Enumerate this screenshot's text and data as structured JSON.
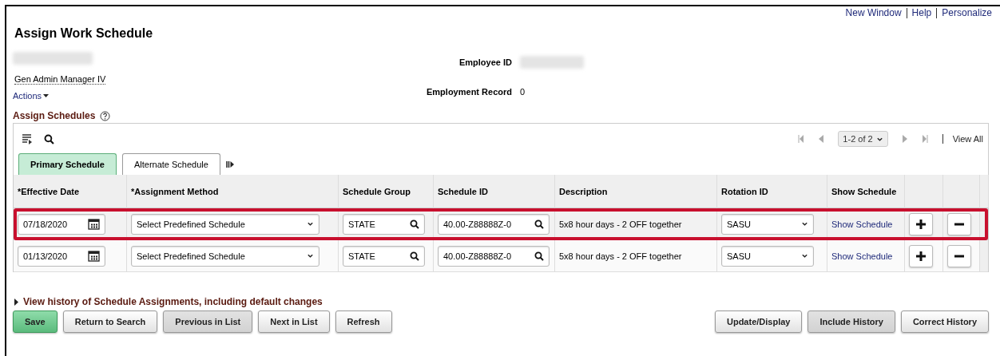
{
  "top_links": [
    "New Window",
    "Help",
    "Personalize"
  ],
  "page_title": "Assign Work Schedule",
  "header": {
    "name": {
      "kind": "redacted"
    },
    "job_title": "Gen Admin Manager IV",
    "actions": "Actions",
    "fields": [
      {
        "label": "Employee ID",
        "value": {
          "kind": "redacted"
        }
      },
      {
        "label": "Employment Record",
        "value": "0"
      }
    ]
  },
  "section_title": "Assign Schedules",
  "pager": {
    "range": "1-2 of 2",
    "view_all": "View All"
  },
  "tabs": [
    {
      "label": "Primary Schedule",
      "selected": true
    },
    {
      "label": "Alternate Schedule",
      "selected": false
    }
  ],
  "table": {
    "columns": [
      "*Effective Date",
      "*Assignment Method",
      "Schedule Group",
      "Schedule ID",
      "Description",
      "Rotation ID",
      "Show Schedule"
    ],
    "rows": [
      {
        "effective_date": "07/18/2020",
        "assignment_method": "Select Predefined Schedule",
        "schedule_group": "STATE",
        "schedule_id": "40.00-Z88888Z-0",
        "description": "5x8 hour days - 2 OFF together",
        "rotation_id": "SASU",
        "show_schedule": "Show Schedule",
        "highlighted": true
      },
      {
        "effective_date": "01/13/2020",
        "assignment_method": "Select Predefined Schedule",
        "schedule_group": "STATE",
        "schedule_id": "40.00-Z88888Z-0",
        "description": "5x8 hour days - 2 OFF together",
        "rotation_id": "SASU",
        "show_schedule": "Show Schedule",
        "highlighted": false
      }
    ]
  },
  "history_link": "View history of Schedule Assignments, including default changes",
  "buttons_left": [
    {
      "label": "Save",
      "kind": "primary",
      "disabled": false
    },
    {
      "label": "Return to Search",
      "kind": "normal",
      "disabled": false
    },
    {
      "label": "Previous in List",
      "kind": "normal",
      "disabled": true
    },
    {
      "label": "Next in List",
      "kind": "normal",
      "disabled": false
    },
    {
      "label": "Refresh",
      "kind": "normal",
      "disabled": false
    }
  ],
  "buttons_right": [
    {
      "label": "Update/Display",
      "kind": "normal",
      "disabled": false
    },
    {
      "label": "Include History",
      "kind": "normal",
      "disabled": true
    },
    {
      "label": "Correct History",
      "kind": "normal",
      "disabled": false
    }
  ]
}
